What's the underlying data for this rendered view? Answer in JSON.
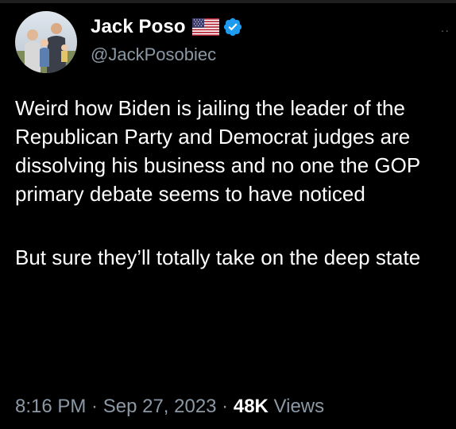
{
  "author": {
    "display_name": "Jack Poso",
    "handle": "@JackPosobiec",
    "flag_icon": "us-flag-icon",
    "badge_icon": "verified-badge-icon",
    "badge_color": "#1d9bf0"
  },
  "menu": {
    "more_label": "··"
  },
  "tweet": {
    "paragraph_1": "Weird how Biden is jailing the leader of the Republican Party and Democrat judges are dissolving his business and no one the GOP primary debate seems to have noticed",
    "paragraph_2": "But sure they’ll totally take on the deep state"
  },
  "meta": {
    "time": "8:16 PM",
    "separator_1": " · ",
    "date": "Sep 27, 2023",
    "separator_2": " · ",
    "views_count": "48K",
    "views_label": " Views"
  },
  "colors": {
    "background": "#000000",
    "text": "#ffffff",
    "muted": "#8b98a5"
  }
}
